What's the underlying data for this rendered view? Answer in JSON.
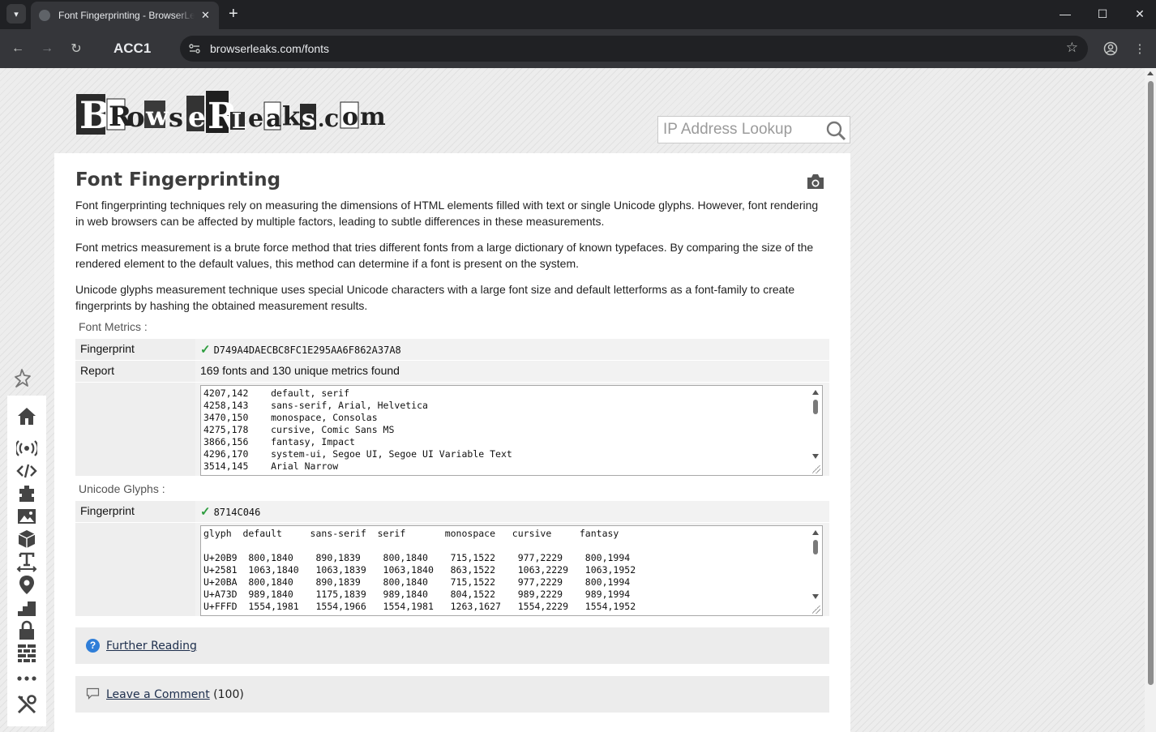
{
  "browser": {
    "tab_title": "Font Fingerprinting - BrowserLeaks",
    "profile_label": "ACC1",
    "url": "browserleaks.com/fonts",
    "icons": [
      "tab-menu-icon",
      "new-tab-icon",
      "minimize-icon",
      "maximize-icon",
      "close-window-icon",
      "back-icon",
      "forward-icon",
      "reload-icon",
      "site-info-icon",
      "bookmark-star-icon",
      "profile-icon",
      "more-menu-icon"
    ]
  },
  "header": {
    "logo_text": "BrowserLeaks.com",
    "search_placeholder": "IP Address Lookup"
  },
  "main": {
    "title": "Font Fingerprinting",
    "paragraphs": [
      "Font fingerprinting techniques rely on measuring the dimensions of HTML elements filled with text or single Unicode glyphs. However, font rendering in web browsers can be affected by multiple factors, leading to subtle differences in these measurements.",
      "Font metrics measurement is a brute force method that tries different fonts from a large dictionary of known typefaces. By comparing the size of the rendered element to the default values, this method can determine if a font is present on the system.",
      "Unicode glyphs measurement technique uses special Unicode characters with a large font size and default letterforms as a font-family to create fingerprints by hashing the obtained measurement results."
    ],
    "font_metrics": {
      "label": "Font Metrics :",
      "fingerprint_key": "Fingerprint",
      "fingerprint_value": "D749A4DAECBC8FC1E295AA6F862A37A8",
      "report_key": "Report",
      "report_value": "169 fonts and 130 unique metrics found",
      "list_text": "4207,142    default, serif\n4258,143    sans-serif, Arial, Helvetica\n3470,150    monospace, Consolas\n4275,178    cursive, Comic Sans MS\n3866,156    fantasy, Impact\n4296,170    system-ui, Segoe UI, Segoe UI Variable Text\n3514,145    Arial Narrow"
    },
    "unicode_glyphs": {
      "label": "Unicode Glyphs :",
      "fingerprint_key": "Fingerprint",
      "fingerprint_value": "8714C046",
      "table_text": "glyph  default     sans-serif  serif       monospace   cursive     fantasy\n\nU+20B9  800,1840    890,1839    800,1840    715,1522    977,2229    800,1994\nU+2581  1063,1840   1063,1839   1063,1840   863,1522    1063,2229   1063,1952\nU+20BA  800,1840    890,1839    800,1840    715,1522    977,2229    800,1994\nU+A73D  989,1840    1175,1839   989,1840    804,1522    989,2229    989,1994\nU+FFFD  1554,1981   1554,1966   1554,1981   1263,1627   1554,2229   1554,1952"
    },
    "further_reading": "Further Reading",
    "leave_comment": "Leave a Comment",
    "comment_count": "(100)"
  },
  "sidebar": {
    "items": [
      "home-icon",
      "broadcast-icon",
      "code-icon",
      "plugin-icon",
      "image-icon",
      "cube-icon",
      "text-width-icon",
      "location-icon",
      "stairs-icon",
      "lock-icon",
      "firewall-icon",
      "more-icon",
      "tools-icon"
    ]
  },
  "colors": {
    "chrome_dark": "#202124",
    "chrome_toolbar": "#35363a",
    "check_green": "#2e9d3f",
    "help_blue": "#2f7ed8",
    "link": "#1e2f4d"
  }
}
